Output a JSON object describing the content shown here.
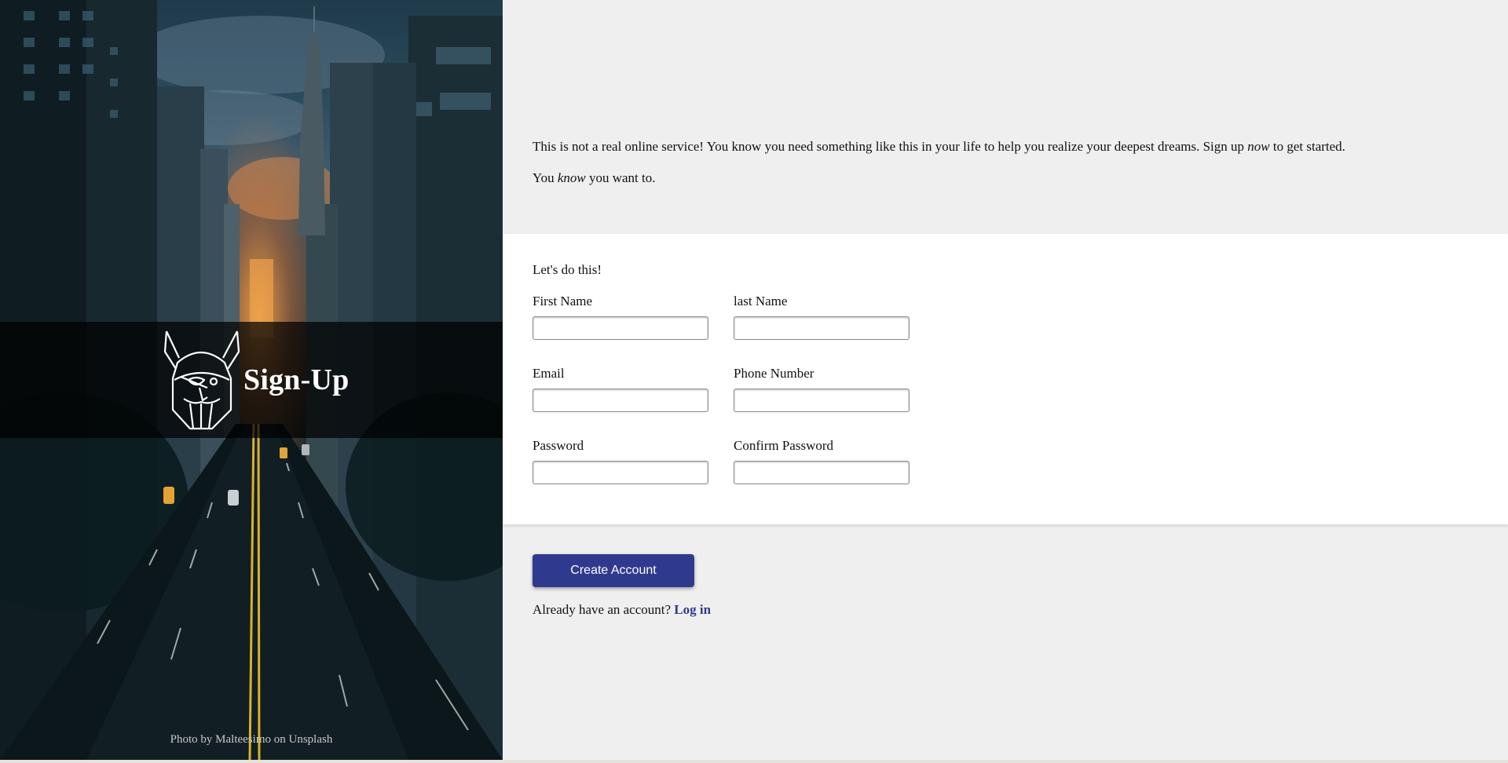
{
  "hero": {
    "brand_title": "Sign-Up",
    "photo_credit": "Photo by Malteesimo on Unsplash",
    "logo_icon": "viking-helmet-icon"
  },
  "intro": {
    "line1_before": "This is not a real online service! You know you need something like this in your life to help you realize your deepest dreams. Sign up ",
    "line1_emphasis": "now",
    "line1_after": " to get started.",
    "line2_before": "You ",
    "line2_emphasis": "know",
    "line2_after": " you want to."
  },
  "form": {
    "heading": "Let's do this!",
    "first_name_label": "First Name",
    "first_name_value": "",
    "last_name_label": "last Name",
    "last_name_value": "",
    "email_label": "Email",
    "email_value": "",
    "phone_label": "Phone Number",
    "phone_value": "",
    "password_label": "Password",
    "password_value": "",
    "confirm_password_label": "Confirm Password",
    "confirm_password_value": ""
  },
  "actions": {
    "create_account_label": "Create Account",
    "login_prompt": "Already have an account?",
    "login_link_label": "Log in"
  },
  "colors": {
    "accent": "#2f3a8f",
    "background": "#efefef",
    "card": "#ffffff",
    "hero_overlay": "#000000"
  }
}
